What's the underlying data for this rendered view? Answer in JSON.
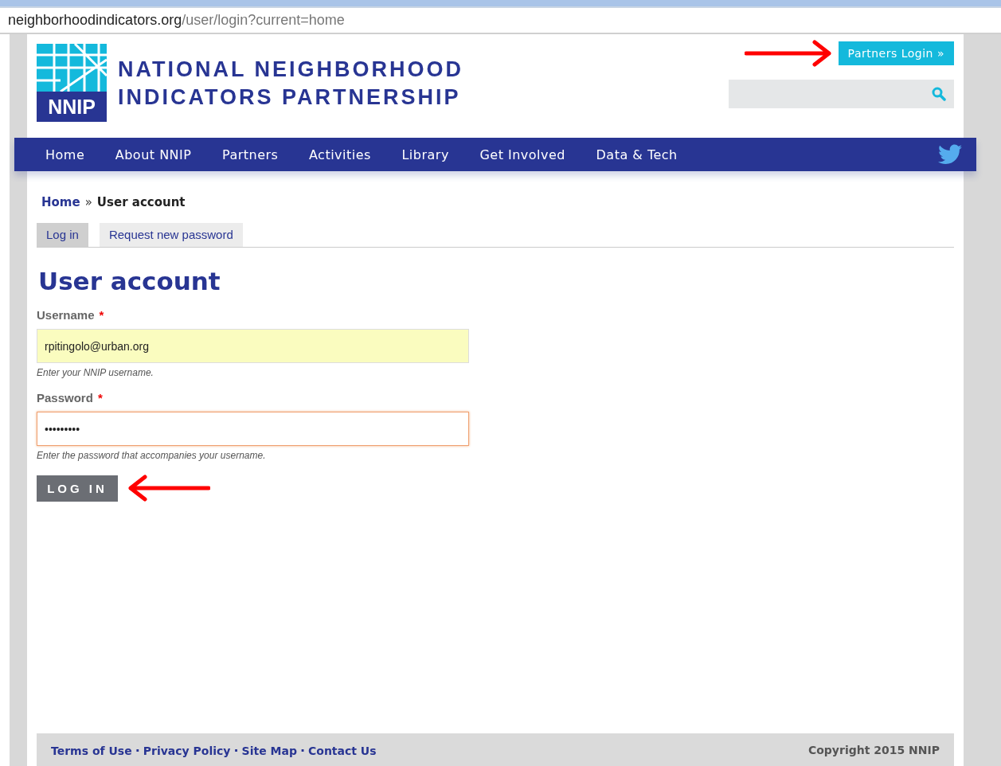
{
  "browser": {
    "url_host": "neighborhoodindicators.org",
    "url_path": "/user/login?current=home"
  },
  "header": {
    "logo_mark": "NNIP",
    "logo_line_1": "NATIONAL NEIGHBORHOOD",
    "logo_line_2": "INDICATORS PARTNERSHIP",
    "partners_login": "Partners Login »"
  },
  "nav": {
    "items": [
      {
        "label": "Home"
      },
      {
        "label": "About NNIP"
      },
      {
        "label": "Partners"
      },
      {
        "label": "Activities"
      },
      {
        "label": "Library"
      },
      {
        "label": "Get Involved"
      },
      {
        "label": "Data & Tech"
      }
    ]
  },
  "breadcrumb": {
    "home": "Home",
    "separator": "»",
    "current": "User account"
  },
  "tabs": [
    {
      "label": "Log in",
      "selected": true
    },
    {
      "label": "Request new password",
      "selected": false
    }
  ],
  "title": "User account",
  "fields": [
    {
      "label": "Username",
      "required_mark": "*",
      "value": "rpitingolo@urban.org",
      "description": "Enter your NNIP username.",
      "focused": false,
      "autofilled": true
    },
    {
      "label": "Password",
      "required_mark": "*",
      "value": "•••••••••",
      "description": "Enter the password that accompanies your username.",
      "focused": true,
      "autofilled": false
    }
  ],
  "submit": "LOG IN",
  "footer": {
    "links": [
      {
        "label": "Terms of Use"
      },
      {
        "label": "Privacy Policy"
      },
      {
        "label": "Site Map"
      },
      {
        "label": "Contact Us"
      }
    ],
    "separator": "·",
    "copyright": "Copyright 2015 NNIP"
  }
}
